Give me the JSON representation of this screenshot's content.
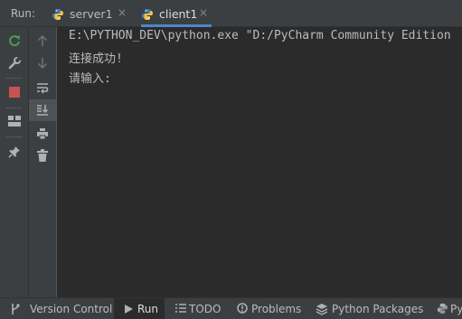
{
  "run_panel": {
    "label": "Run:",
    "tabs": [
      {
        "label": "server1",
        "active": false
      },
      {
        "label": "client1",
        "active": true
      }
    ],
    "close_glyph": "×"
  },
  "toolbar_left": [
    {
      "name": "rerun-icon",
      "color": "#499c54"
    },
    {
      "name": "wrench-icon",
      "color": "#afb1b3"
    },
    {
      "name": "stop-icon",
      "color": "#c75450"
    },
    {
      "name": "layout-icon",
      "color": "#afb1b3"
    },
    {
      "name": "pin-icon",
      "color": "#afb1b3"
    }
  ],
  "toolbar_right": [
    {
      "name": "arrow-up-icon"
    },
    {
      "name": "arrow-down-icon"
    },
    {
      "name": "soft-wrap-icon"
    },
    {
      "name": "scroll-to-end-icon",
      "selected": true
    },
    {
      "name": "print-icon"
    },
    {
      "name": "trash-icon"
    }
  ],
  "console": {
    "lines": [
      "E:\\PYTHON_DEV\\python.exe \"D:/PyCharm Community Edition",
      "连接成功!",
      "请输入:"
    ]
  },
  "statusbar": {
    "items": [
      {
        "label": "Version Control",
        "icon": "branch-icon"
      },
      {
        "label": "Run",
        "icon": "run-icon",
        "active": true
      },
      {
        "label": "TODO",
        "icon": "todo-list-icon"
      },
      {
        "label": "Problems",
        "icon": "problems-icon"
      },
      {
        "label": "Python Packages",
        "icon": "packages-icon"
      },
      {
        "label": "Py",
        "icon": "python-console-icon"
      }
    ]
  }
}
